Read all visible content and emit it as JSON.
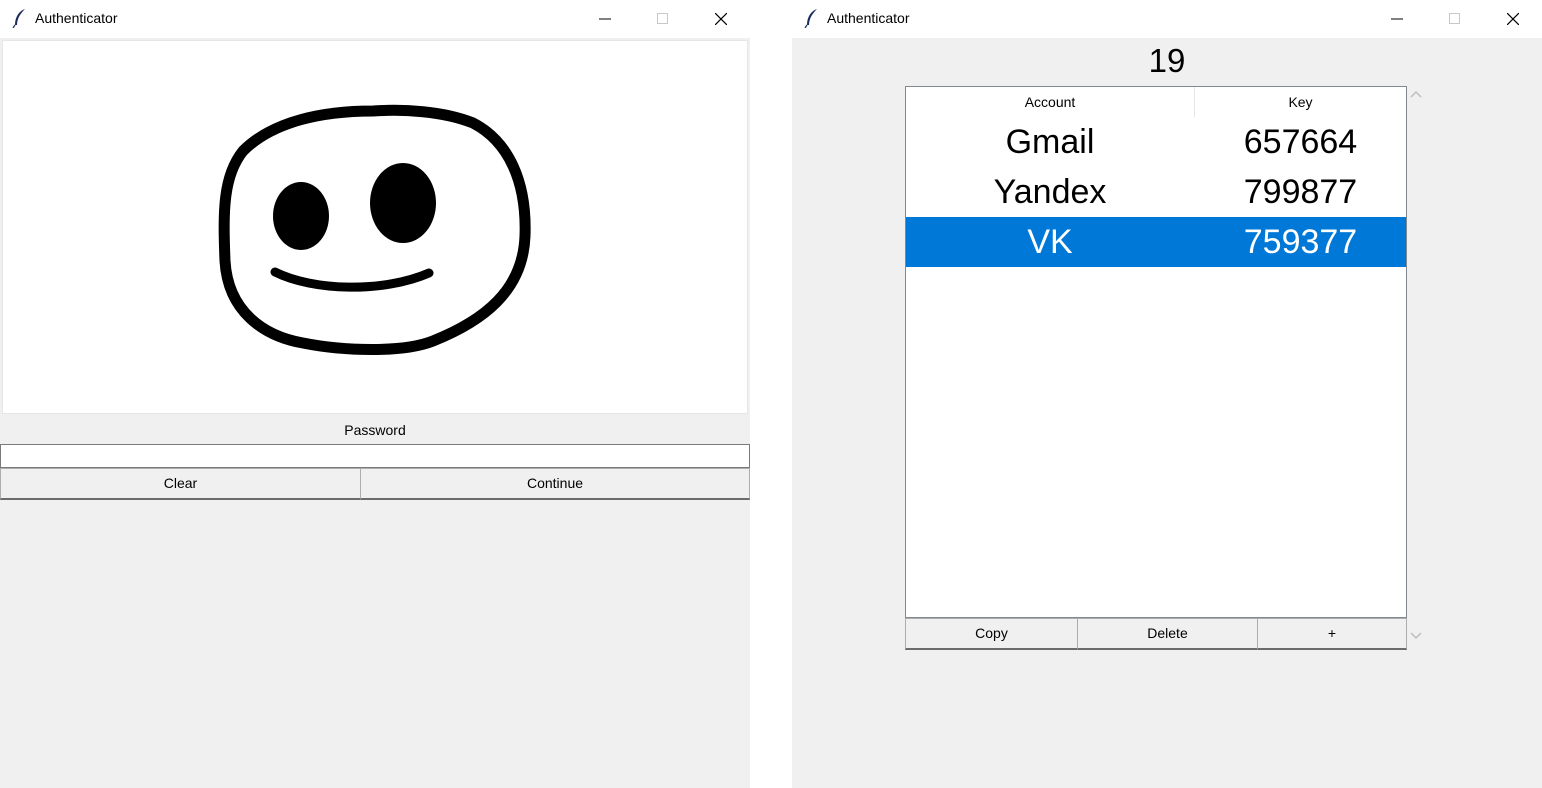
{
  "left_window": {
    "title": "Authenticator",
    "password_label": "Password",
    "password_value": "",
    "clear_label": "Clear",
    "continue_label": "Continue"
  },
  "right_window": {
    "title": "Authenticator",
    "timer": "19",
    "table": {
      "columns": [
        "Account",
        "Key"
      ],
      "rows": [
        {
          "account": "Gmail",
          "key": "657664",
          "selected": false
        },
        {
          "account": "Yandex",
          "key": "799877",
          "selected": false
        },
        {
          "account": "VK",
          "key": "759377",
          "selected": true
        }
      ]
    },
    "copy_label": "Copy",
    "delete_label": "Delete",
    "add_label": "+"
  },
  "icons": {
    "app": "feather-icon",
    "minimize": "minimize-icon",
    "maximize": "maximize-icon",
    "close": "close-icon",
    "scroll_up": "chevron-up-icon",
    "scroll_down": "chevron-down-icon"
  },
  "colors": {
    "selection": "#0078d7",
    "window_bg": "#f0f0f0"
  }
}
